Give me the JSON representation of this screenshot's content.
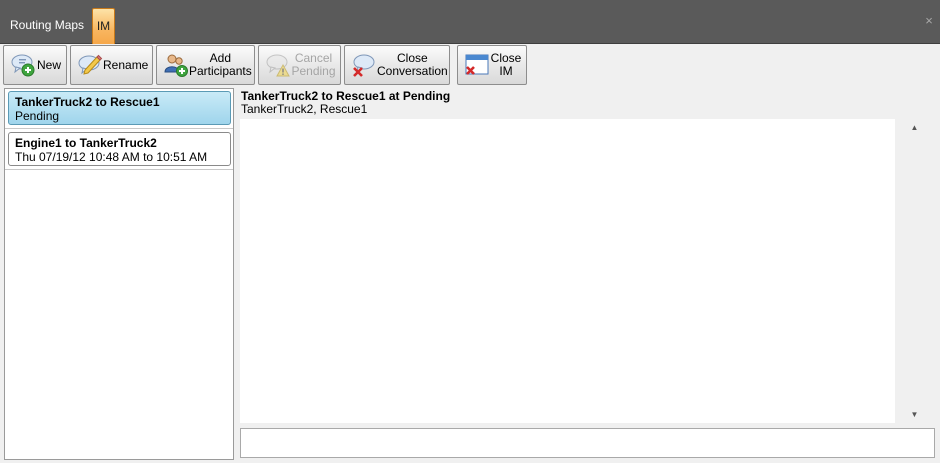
{
  "tabs": [
    {
      "label": "Routing Maps",
      "active": false
    },
    {
      "label": "IM",
      "active": true
    }
  ],
  "close_glyph": "×",
  "toolbar": {
    "new_label": "New",
    "rename_label": "Rename",
    "add_participants_line1": "Add",
    "add_participants_line2": "Participants",
    "cancel_pending_line1": "Cancel",
    "cancel_pending_line2": "Pending",
    "close_conversation_line1": "Close",
    "close_conversation_line2": "Conversation",
    "close_im_line1": "Close",
    "close_im_line2": "IM"
  },
  "conversations": [
    {
      "title": "TankerTruck2 to Rescue1",
      "subtitle": "Pending",
      "selected": true
    },
    {
      "title": "Engine1 to TankerTruck2",
      "subtitle": "Thu 07/19/12 10:48 AM to 10:51 AM",
      "selected": false
    }
  ],
  "conversation_header": {
    "title": "TankerTruck2 to Rescue1 at Pending",
    "participants": "TankerTruck2, Rescue1"
  },
  "message_input": {
    "value": "",
    "placeholder": ""
  },
  "scroll_up_glyph": "▲",
  "scroll_down_glyph": "▼",
  "colors": {
    "titlebar": "#5a5a5a",
    "active_tab": "#f8b660",
    "selected_item": "#9fd5ec"
  }
}
